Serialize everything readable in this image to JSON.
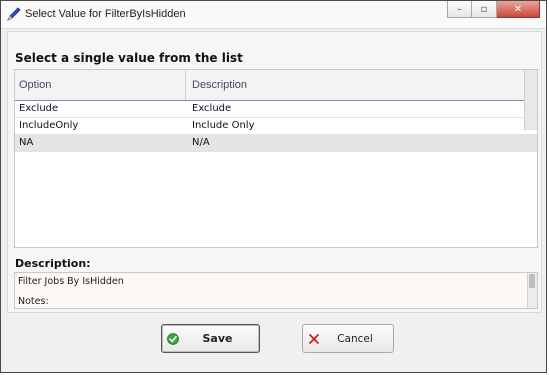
{
  "window": {
    "title": "Select Value for FilterByIsHidden",
    "controls": {
      "minimize": "–",
      "maximize": "▫",
      "close": "✕"
    }
  },
  "instruction": "Select a single value from the list",
  "grid": {
    "columns": [
      "Option",
      "Description"
    ],
    "rows": [
      {
        "option": "Exclude",
        "description": "Exclude"
      },
      {
        "option": "IncludeOnly",
        "description": "Include Only"
      },
      {
        "option": "NA",
        "description": "N/A"
      }
    ],
    "selected_option": "NA"
  },
  "description": {
    "label": "Description:",
    "line1": "Filter Jobs By IsHidden",
    "line2": "Notes:"
  },
  "buttons": {
    "save_label": "Save",
    "cancel_label": "Cancel"
  },
  "colors": {
    "header_text": "#4a4470",
    "header_underline": "#7f8fb3",
    "selected_row": "#e4e4e4",
    "close_button": "#c9483a",
    "save_icon": "#3aa53a",
    "cancel_icon": "#d02020"
  },
  "icons": {
    "app": "pen-icon",
    "save": "checkmark-circle-icon",
    "cancel": "x-icon"
  }
}
